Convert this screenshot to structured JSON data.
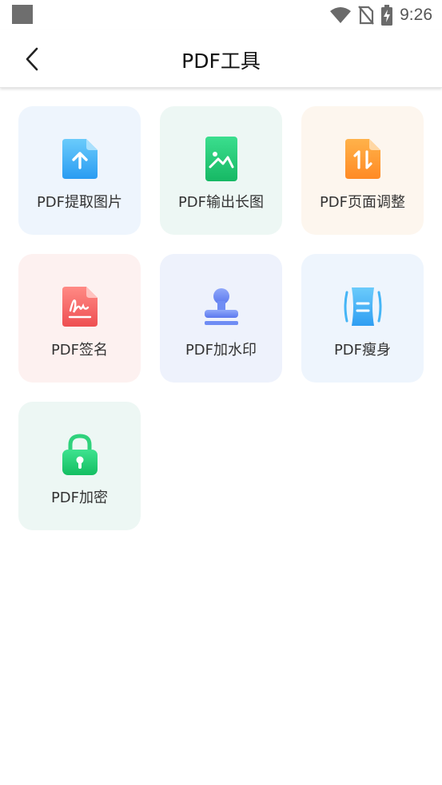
{
  "status_bar": {
    "time": "9:26",
    "icons": [
      "notification-square",
      "wifi-icon",
      "no-sim-icon",
      "battery-charging-icon"
    ]
  },
  "header": {
    "title": "PDF工具",
    "back_icon": "chevron-left-icon"
  },
  "tools": [
    {
      "label": "PDF提取图片",
      "icon": "pdf-extract-image-icon",
      "bg": "#EEF5FD",
      "accent": "#3DAEF5"
    },
    {
      "label": "PDF输出长图",
      "icon": "pdf-long-image-icon",
      "bg": "#EDF7F4",
      "accent": "#1FC777"
    },
    {
      "label": "PDF页面调整",
      "icon": "pdf-page-adjust-icon",
      "bg": "#FDF6EE",
      "accent": "#FF9A30"
    },
    {
      "label": "PDF签名",
      "icon": "pdf-signature-icon",
      "bg": "#FDF1F0",
      "accent": "#F26464"
    },
    {
      "label": "PDF加水印",
      "icon": "pdf-watermark-stamp-icon",
      "bg": "#EEF2FC",
      "accent": "#6C8BF2"
    },
    {
      "label": "PDF瘦身",
      "icon": "pdf-compress-icon",
      "bg": "#EEF5FD",
      "accent": "#3DB4F5"
    },
    {
      "label": "PDF加密",
      "icon": "pdf-encrypt-lock-icon",
      "bg": "#EDF7F4",
      "accent": "#20CE6E"
    }
  ]
}
